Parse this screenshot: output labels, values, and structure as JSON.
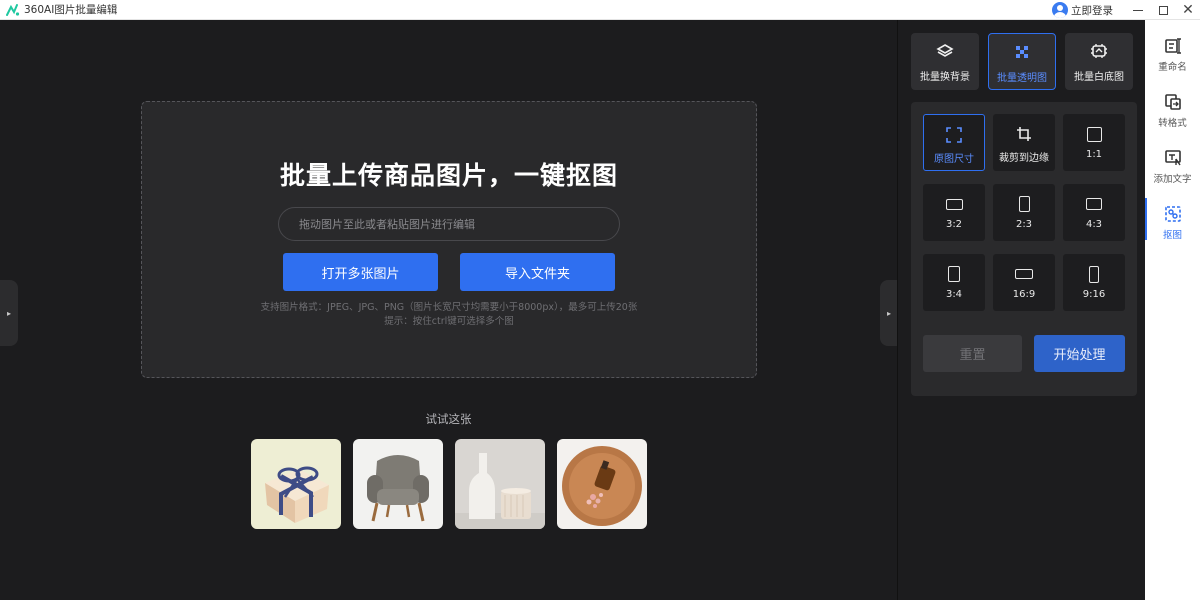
{
  "window": {
    "title": "360AI图片批量编辑",
    "login_label": "立即登录",
    "controls": [
      "minimize-icon",
      "maximize-icon",
      "close-icon"
    ]
  },
  "upload": {
    "title": "批量上传商品图片，一键抠图",
    "input_placeholder": "拖动图片至此或者粘贴图片进行编辑",
    "open_button": "打开多张图片",
    "folder_button": "导入文件夹",
    "hint_formats": "支持图片格式：JPEG、JPG、PNG（图片长宽尺寸均需要小于8000px），最多可上传20张",
    "hint_ctrl": "提示：按住ctrl键可选择多个图"
  },
  "samples": {
    "label": "试试这张",
    "items": [
      "gift-box-image",
      "armchair-image",
      "vase-image",
      "perfume-tray-image"
    ]
  },
  "modes": [
    {
      "label": "批量换背景",
      "icon": "layers-icon",
      "active": false
    },
    {
      "label": "批量透明图",
      "icon": "transparent-grid-icon",
      "active": true
    },
    {
      "label": "批量白底图",
      "icon": "white-bg-icon",
      "active": false
    }
  ],
  "ratios": [
    {
      "label": "原图尺寸",
      "active": true
    },
    {
      "label": "裁剪到边缘",
      "active": false
    },
    {
      "label": "1:1",
      "active": false
    },
    {
      "label": "3:2",
      "active": false
    },
    {
      "label": "2:3",
      "active": false
    },
    {
      "label": "4:3",
      "active": false
    },
    {
      "label": "3:4",
      "active": false
    },
    {
      "label": "16:9",
      "active": false
    },
    {
      "label": "9:16",
      "active": false
    }
  ],
  "actions": {
    "reset_label": "重置",
    "start_label": "开始处理"
  },
  "toolbar": [
    {
      "label": "重命名",
      "icon": "rename-icon",
      "active": false
    },
    {
      "label": "转格式",
      "icon": "convert-format-icon",
      "active": false
    },
    {
      "label": "添加文字",
      "icon": "add-text-icon",
      "active": false
    },
    {
      "label": "抠图",
      "icon": "cutout-icon",
      "active": true
    }
  ],
  "colors": {
    "accent": "#2f6ff0",
    "background": "#1c1c1e",
    "panel": "#2a2a2c"
  }
}
